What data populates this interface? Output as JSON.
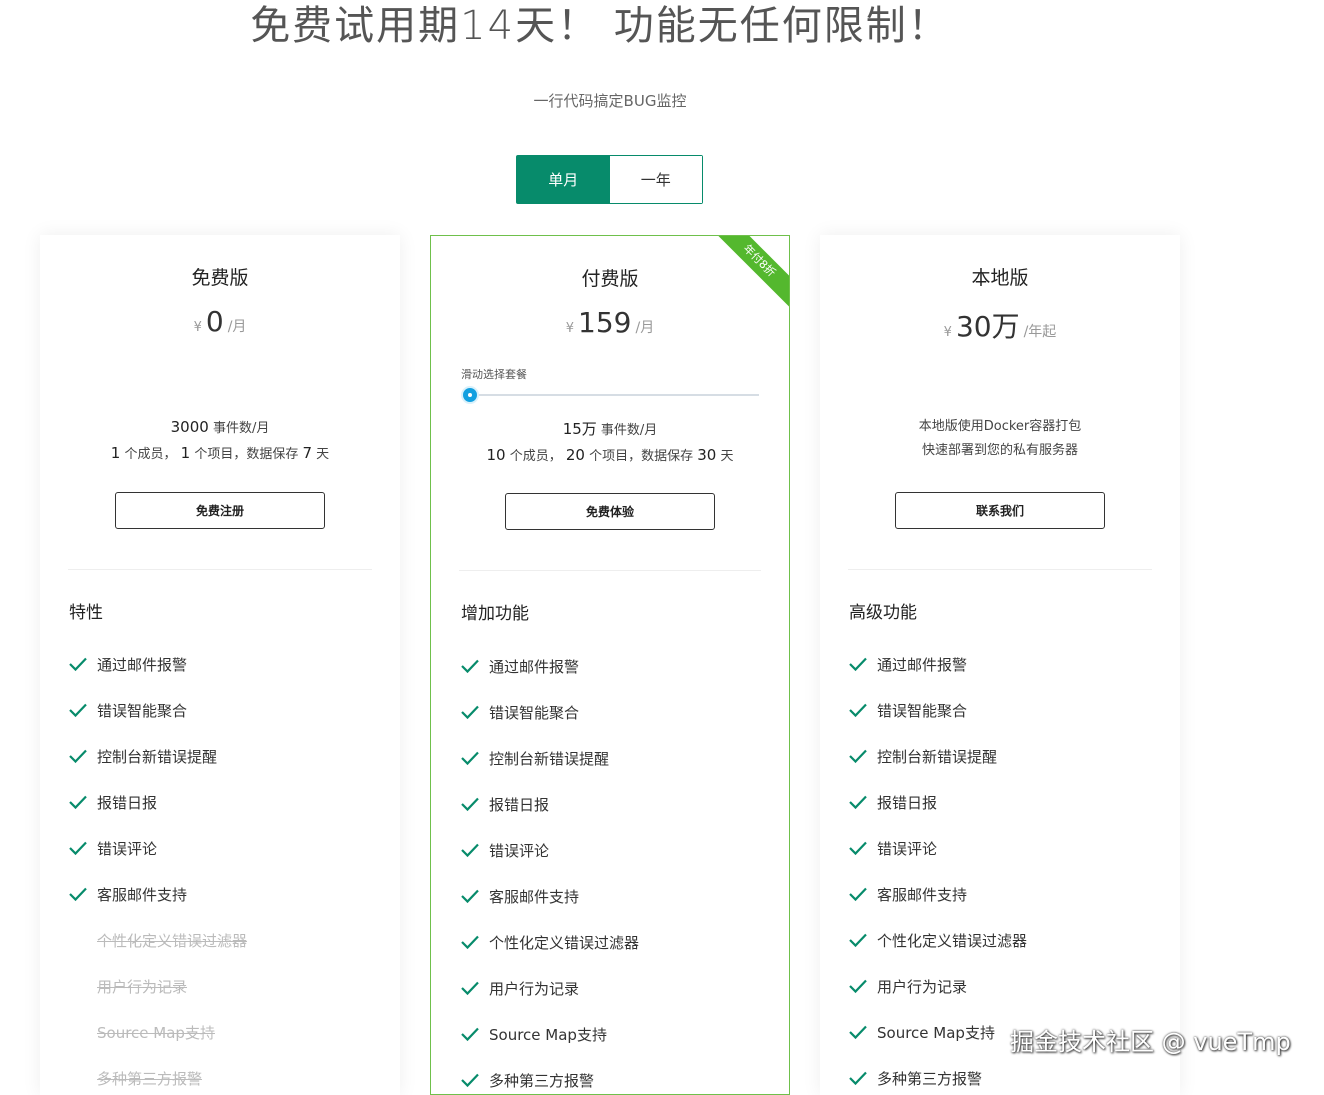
{
  "hero": {
    "title": "免费试用期14天！ 功能无任何限制！",
    "subtitle": "一行代码搞定BUG监控"
  },
  "period_toggle": {
    "monthly": "单月",
    "yearly": "一年",
    "selected": "monthly"
  },
  "colors": {
    "accent": "#078b6b",
    "check": "#078b6b",
    "featured_border": "#6fc04b",
    "ribbon": "#54b82e",
    "slider": "#12a0e0"
  },
  "plans": [
    {
      "name": "免费版",
      "currency": "¥",
      "price": "0",
      "unit": "/月",
      "line1_num": "3000",
      "line1_text": "事件数/月",
      "line2": {
        "members": "1",
        "members_label": "个成员，",
        "projects": "1",
        "projects_label": "个项目，数据保存",
        "days": "7",
        "days_label": "天"
      },
      "button": "免费注册",
      "features_title": "特性",
      "features": [
        {
          "label": "通过邮件报警",
          "enabled": true
        },
        {
          "label": "错误智能聚合",
          "enabled": true
        },
        {
          "label": "控制台新错误提醒",
          "enabled": true
        },
        {
          "label": "报错日报",
          "enabled": true
        },
        {
          "label": "错误评论",
          "enabled": true
        },
        {
          "label": "客服邮件支持",
          "enabled": true
        },
        {
          "label": "个性化定义错误过滤器",
          "enabled": false
        },
        {
          "label": "用户行为记录",
          "enabled": false
        },
        {
          "label": "Source Map支持",
          "enabled": false
        },
        {
          "label": "多种第三方报警",
          "enabled": false
        }
      ]
    },
    {
      "name": "付费版",
      "currency": "¥",
      "price": "159",
      "unit": "/月",
      "ribbon": "年付8折",
      "slider_label": "滑动选择套餐",
      "slider_value": 0,
      "line1_num": "15万",
      "line1_text": "事件数/月",
      "line2": {
        "members": "10",
        "members_label": "个成员，",
        "projects": "20",
        "projects_label": "个项目，数据保存",
        "days": "30",
        "days_label": "天"
      },
      "button": "免费体验",
      "features_title": "增加功能",
      "features": [
        {
          "label": "通过邮件报警",
          "enabled": true
        },
        {
          "label": "错误智能聚合",
          "enabled": true
        },
        {
          "label": "控制台新错误提醒",
          "enabled": true
        },
        {
          "label": "报错日报",
          "enabled": true
        },
        {
          "label": "错误评论",
          "enabled": true
        },
        {
          "label": "客服邮件支持",
          "enabled": true
        },
        {
          "label": "个性化定义错误过滤器",
          "enabled": true
        },
        {
          "label": "用户行为记录",
          "enabled": true
        },
        {
          "label": "Source Map支持",
          "enabled": true
        },
        {
          "label": "多种第三方报警",
          "enabled": true
        }
      ]
    },
    {
      "name": "本地版",
      "currency": "¥",
      "price": "30万",
      "unit": "/年起",
      "desc_line1": "本地版使用Docker容器打包",
      "desc_line2": "快速部署到您的私有服务器",
      "button": "联系我们",
      "features_title": "高级功能",
      "features": [
        {
          "label": "通过邮件报警",
          "enabled": true
        },
        {
          "label": "错误智能聚合",
          "enabled": true
        },
        {
          "label": "控制台新错误提醒",
          "enabled": true
        },
        {
          "label": "报错日报",
          "enabled": true
        },
        {
          "label": "错误评论",
          "enabled": true
        },
        {
          "label": "客服邮件支持",
          "enabled": true
        },
        {
          "label": "个性化定义错误过滤器",
          "enabled": true
        },
        {
          "label": "用户行为记录",
          "enabled": true
        },
        {
          "label": "Source Map支持",
          "enabled": true
        },
        {
          "label": "多种第三方报警",
          "enabled": true
        }
      ]
    }
  ],
  "watermark": "掘金技术社区 @ vueTmp"
}
